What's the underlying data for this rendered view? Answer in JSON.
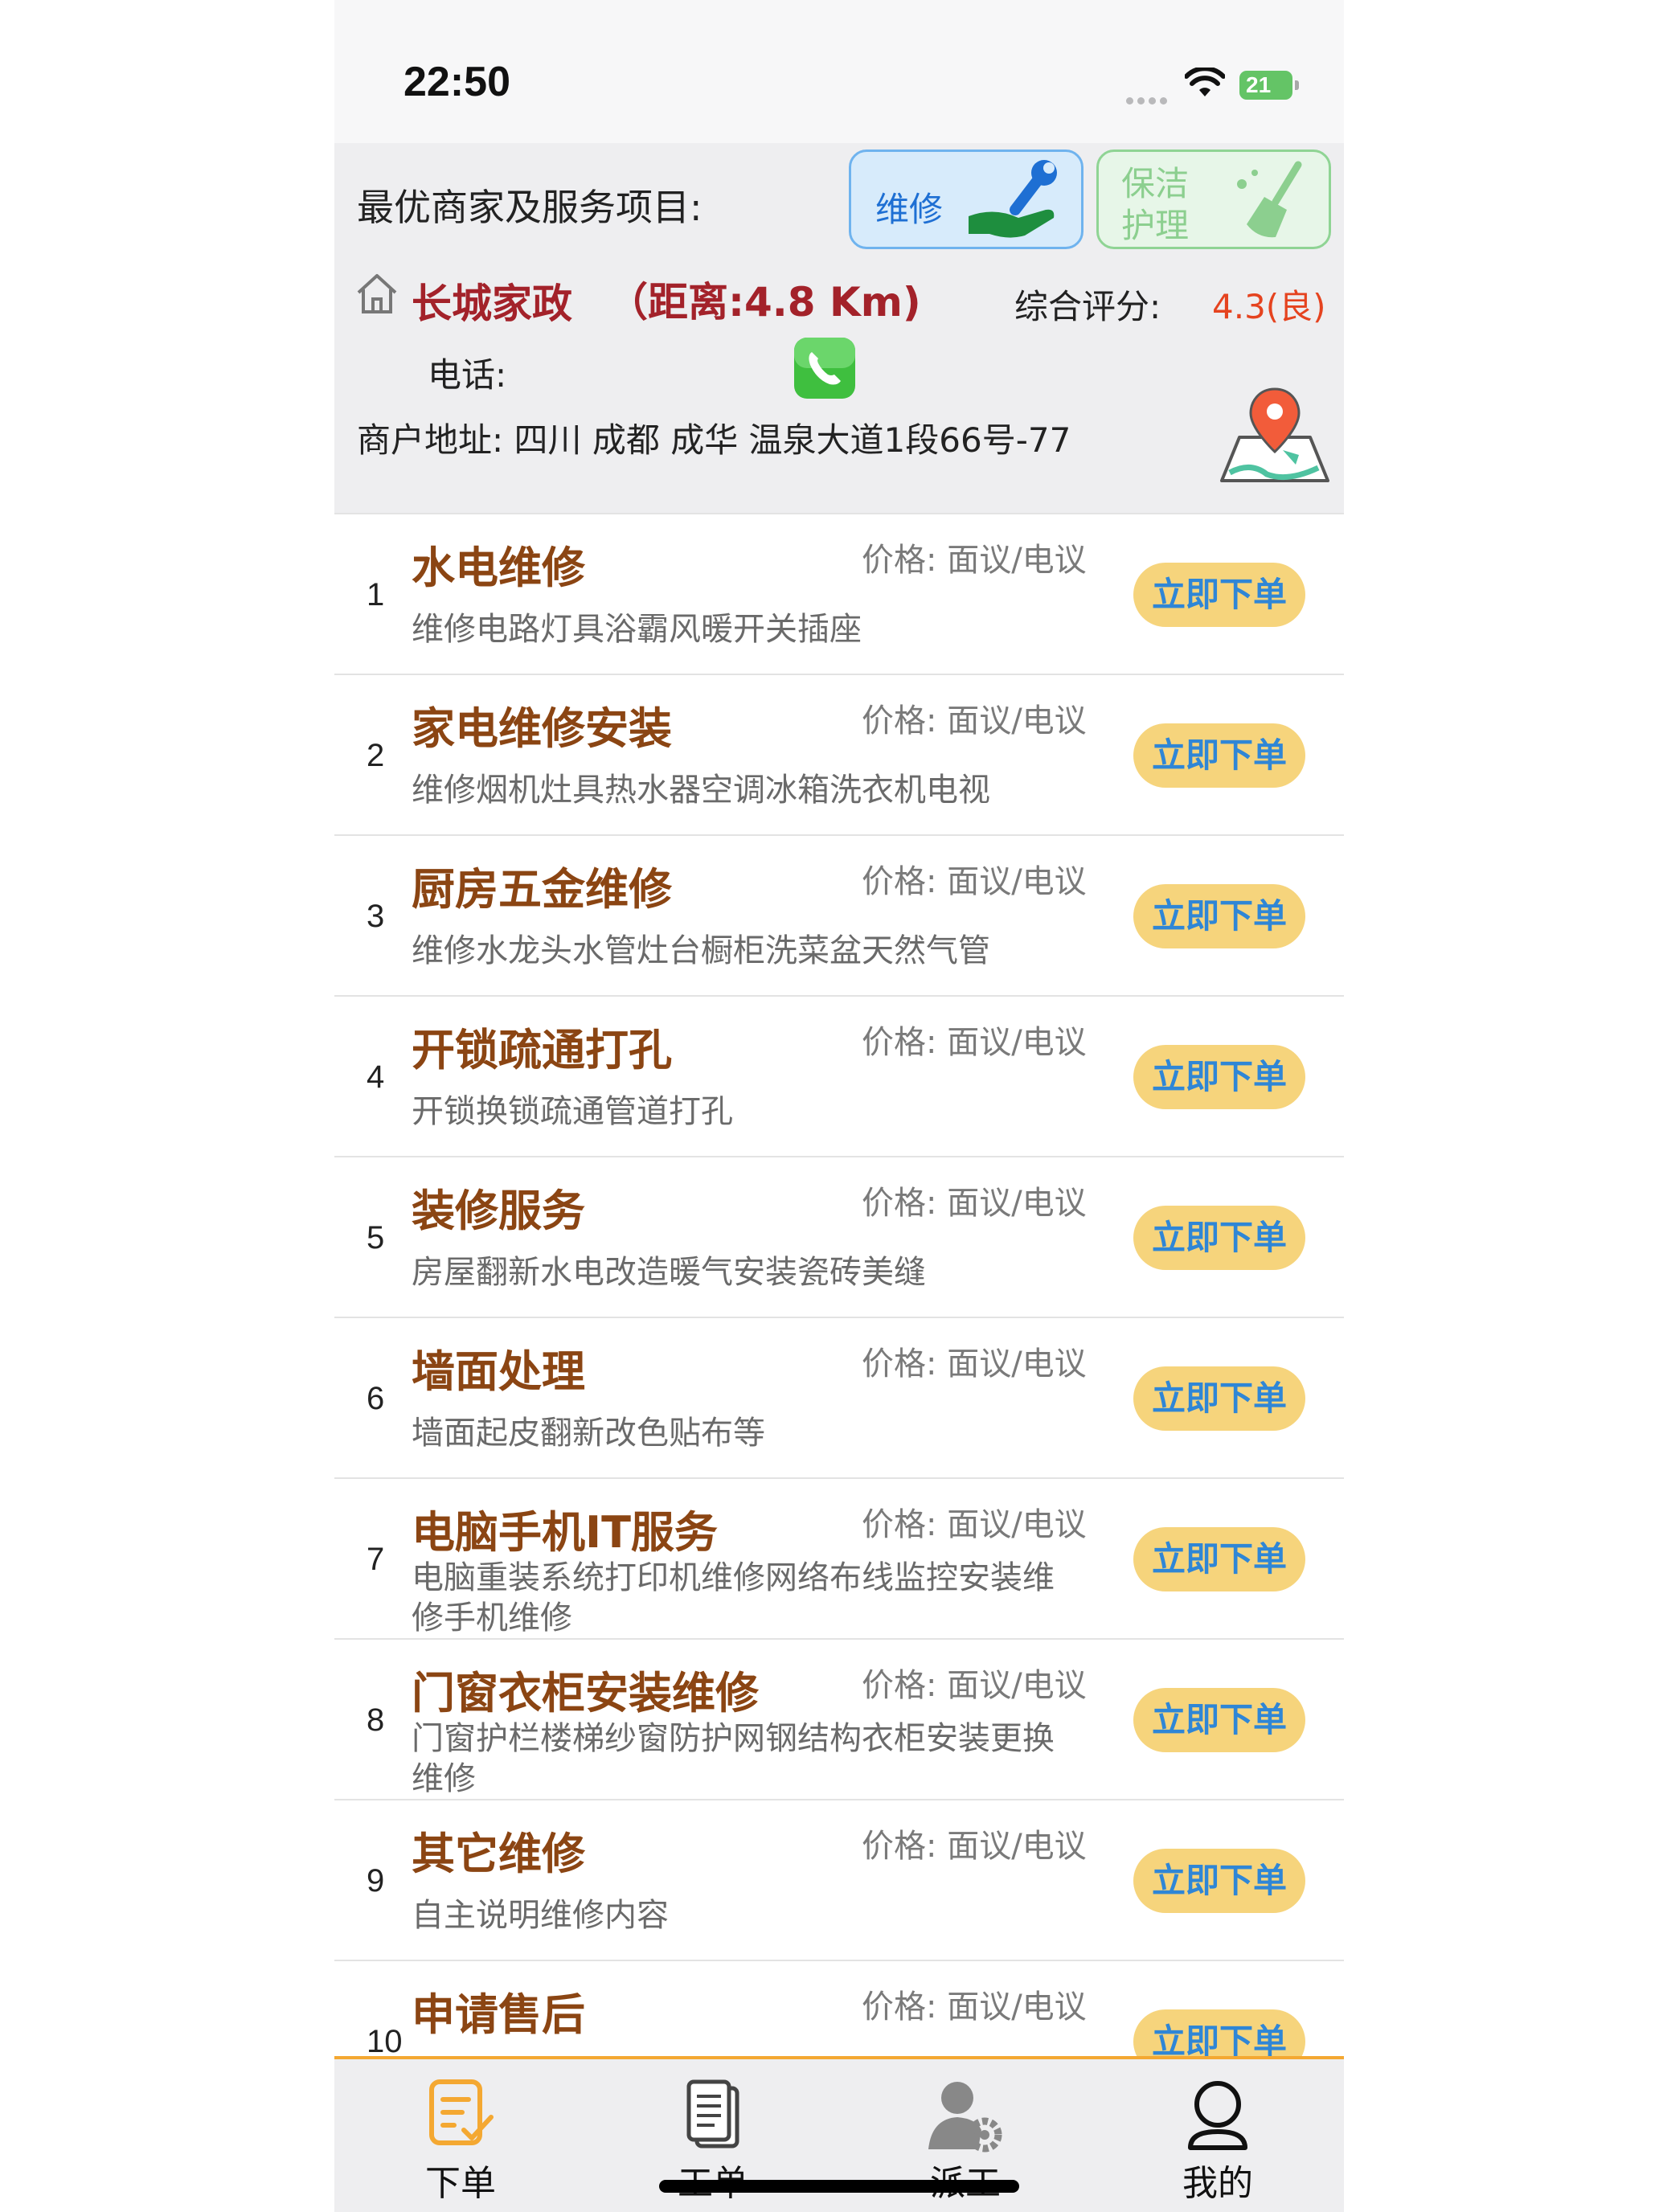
{
  "status_bar": {
    "time": "22:50",
    "battery": "21"
  },
  "merchant": {
    "section_title": "最优商家及服务项目:",
    "categories": [
      {
        "label": "维修",
        "icon": "repair-hand-wrench-icon",
        "selected": true
      },
      {
        "label": "保洁护理",
        "icon": "broom-icon",
        "selected": false
      }
    ],
    "name": "长城家政",
    "distance": "（距离:4.8 Km)",
    "rating_label": "综合评分:",
    "rating_value": "4.3(良)",
    "phone_label": "电话:",
    "address": "商户地址: 四川 成都 成华 温泉大道1段66号-77"
  },
  "services": [
    {
      "index": "1",
      "name": "水电维修",
      "price": "价格: 面议/电议",
      "desc": "维修电路灯具浴霸风暖开关插座",
      "button": "立即下单"
    },
    {
      "index": "2",
      "name": "家电维修安装",
      "price": "价格: 面议/电议",
      "desc": "维修烟机灶具热水器空调冰箱洗衣机电视",
      "button": "立即下单"
    },
    {
      "index": "3",
      "name": "厨房五金维修",
      "price": "价格: 面议/电议",
      "desc": "维修水龙头水管灶台橱柜洗菜盆天然气管",
      "button": "立即下单"
    },
    {
      "index": "4",
      "name": "开锁疏通打孔",
      "price": "价格: 面议/电议",
      "desc": "开锁换锁疏通管道打孔",
      "button": "立即下单"
    },
    {
      "index": "5",
      "name": "装修服务",
      "price": "价格: 面议/电议",
      "desc": "房屋翻新水电改造暖气安装瓷砖美缝",
      "button": "立即下单"
    },
    {
      "index": "6",
      "name": "墙面处理",
      "price": "价格: 面议/电议",
      "desc": "墙面起皮翻新改色贴布等",
      "button": "立即下单"
    },
    {
      "index": "7",
      "name": "电脑手机IT服务",
      "price": "价格: 面议/电议",
      "desc": "电脑重装系统打印机维修网络布线监控安装维修手机维修",
      "button": "立即下单"
    },
    {
      "index": "8",
      "name": "门窗衣柜安装维修",
      "price": "价格: 面议/电议",
      "desc": "门窗护栏楼梯纱窗防护网钢结构衣柜安装更换维修",
      "button": "立即下单"
    },
    {
      "index": "9",
      "name": "其它维修",
      "price": "价格: 面议/电议",
      "desc": "自主说明维修内容",
      "button": "立即下单"
    },
    {
      "index": "10",
      "name": "申请售后",
      "price": "价格: 面议/电议",
      "desc": "",
      "button": "立即下单"
    }
  ],
  "tabbar": {
    "tabs": [
      {
        "label": "下单",
        "icon": "order-form-icon",
        "active": true
      },
      {
        "label": "工单",
        "icon": "documents-icon",
        "active": false
      },
      {
        "label": "派工",
        "icon": "worker-gear-icon",
        "active": false
      },
      {
        "label": "我的",
        "icon": "profile-icon",
        "active": false
      }
    ]
  },
  "colors": {
    "accent": "#f4a832",
    "service_name": "#8b4513",
    "merchant_name": "#a3222a",
    "button_bg": "#f6d47c",
    "button_text": "#2f86d6"
  }
}
